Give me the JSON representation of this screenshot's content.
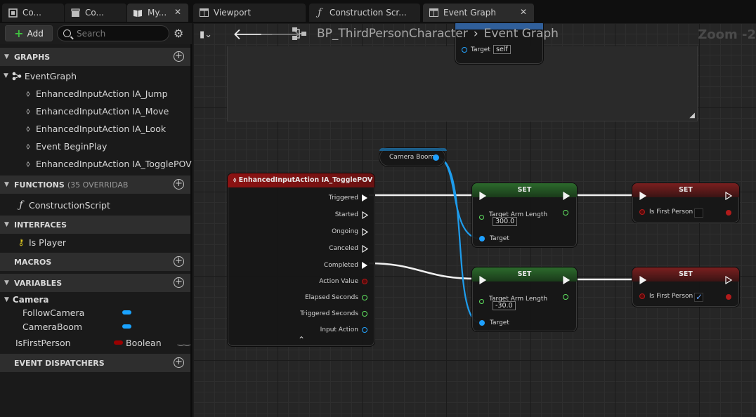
{
  "tabs": [
    {
      "label": "Co...",
      "icon": "level-icon"
    },
    {
      "label": "Co...",
      "icon": "clapper-icon"
    },
    {
      "label": "My...",
      "icon": "book-icon"
    },
    {
      "label": "Viewport",
      "icon": "grid-icon"
    },
    {
      "label": "Construction Scr...",
      "icon": "function-icon"
    },
    {
      "label": "Event Graph",
      "icon": "graph-icon"
    }
  ],
  "left": {
    "add_label": "Add",
    "search_placeholder": "Search",
    "graphs": {
      "title": "GRAPHS",
      "event_graph": "EventGraph",
      "items": [
        "EnhancedInputAction IA_Jump",
        "EnhancedInputAction IA_Move",
        "EnhancedInputAction IA_Look",
        "Event BeginPlay",
        "EnhancedInputAction IA_TogglePOV"
      ]
    },
    "functions": {
      "title": "FUNCTIONS",
      "count": "(35 OVERRIDAB",
      "items": [
        "ConstructionScript"
      ]
    },
    "interfaces": {
      "title": "INTERFACES",
      "items": [
        "Is Player"
      ]
    },
    "macros": {
      "title": "MACROS"
    },
    "variables": {
      "title": "VARIABLES",
      "category": "Camera",
      "items": [
        {
          "name": "FollowCamera",
          "color": "#1aa3ff"
        },
        {
          "name": "CameraBoom",
          "color": "#1aa3ff"
        },
        {
          "name": "IsFirstPerson",
          "color": "#9a0000",
          "type": "Boolean"
        }
      ]
    },
    "dispatchers": {
      "title": "EVENT DISPATCHERS"
    }
  },
  "graph": {
    "breadcrumb_root": "BP_ThirdPersonCharacter",
    "breadcrumb_leaf": "Event Graph",
    "zoom": "Zoom -2",
    "top_node": {
      "target_label": "Target",
      "target_value": "self"
    },
    "camera_boom": "Camera Boom",
    "event_node": {
      "title": "EnhancedInputAction IA_TogglePOV",
      "pins": [
        "Triggered",
        "Started",
        "Ongoing",
        "Canceled",
        "Completed",
        "Action Value",
        "Elapsed Seconds",
        "Triggered Seconds",
        "Input Action"
      ]
    },
    "set1": {
      "title": "SET",
      "pin": "Target Arm Length",
      "value": "300.0",
      "target": "Target"
    },
    "set2": {
      "title": "SET",
      "pin": "Target Arm Length",
      "value": "-30.0",
      "target": "Target"
    },
    "set3": {
      "title": "SET",
      "pin": "Is First Person",
      "checked": false
    },
    "set4": {
      "title": "SET",
      "pin": "Is First Person",
      "checked": true
    }
  }
}
